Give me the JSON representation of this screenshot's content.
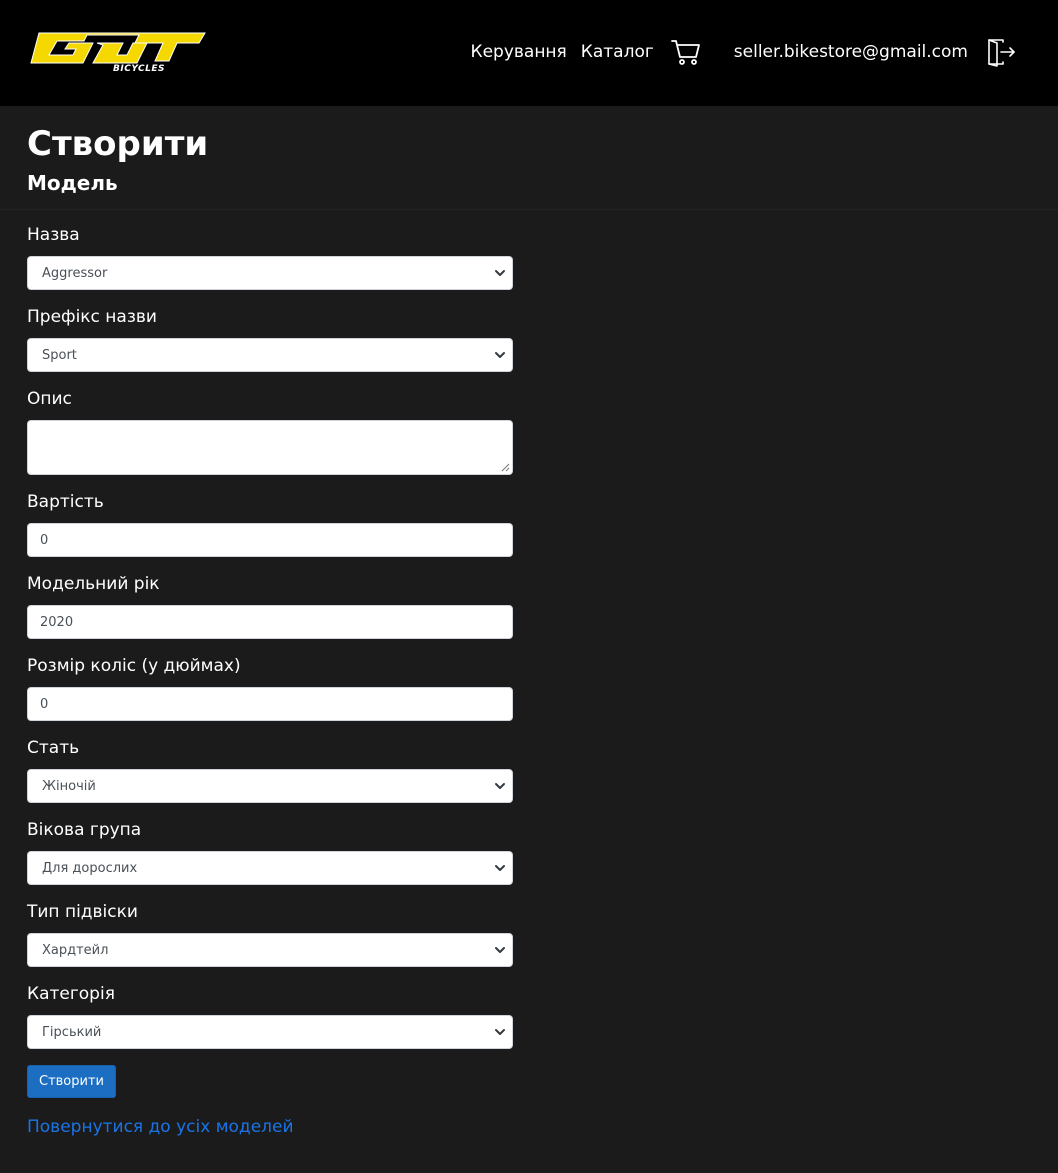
{
  "header": {
    "logo_text": "GT",
    "logo_subtext": "BICYCLES",
    "nav_links": [
      "Керування",
      "Каталог"
    ],
    "user_email": "seller.bikestore@gmail.com",
    "icons": [
      "cart-icon",
      "logout-icon"
    ]
  },
  "page": {
    "title": "Створити",
    "subtitle": "Модель"
  },
  "form": {
    "name": {
      "label": "Назва",
      "value": "Aggressor"
    },
    "name_prefix": {
      "label": "Префікс назви",
      "value": "Sport"
    },
    "description": {
      "label": "Опис",
      "value": ""
    },
    "price": {
      "label": "Вартість",
      "value": "0"
    },
    "model_year": {
      "label": "Модельний рік",
      "value": "2020"
    },
    "wheel_size": {
      "label": "Розмір коліс (у дюймах)",
      "value": "0"
    },
    "gender": {
      "label": "Стать",
      "value": "Жіночій"
    },
    "age_group": {
      "label": "Вікова група",
      "value": "Для дорослих"
    },
    "suspension_type": {
      "label": "Тип підвіски",
      "value": "Хардтейл"
    },
    "category": {
      "label": "Категорія",
      "value": "Гірський"
    },
    "submit_label": "Створити"
  },
  "back_link": "Повернутися до усіх моделей",
  "colors": {
    "navbar_bg": "#000000",
    "page_bg": "#1b1b1b",
    "primary_button": "#1b6ec2",
    "link": "#1a74e6",
    "logo_yellow": "#f5d800"
  }
}
